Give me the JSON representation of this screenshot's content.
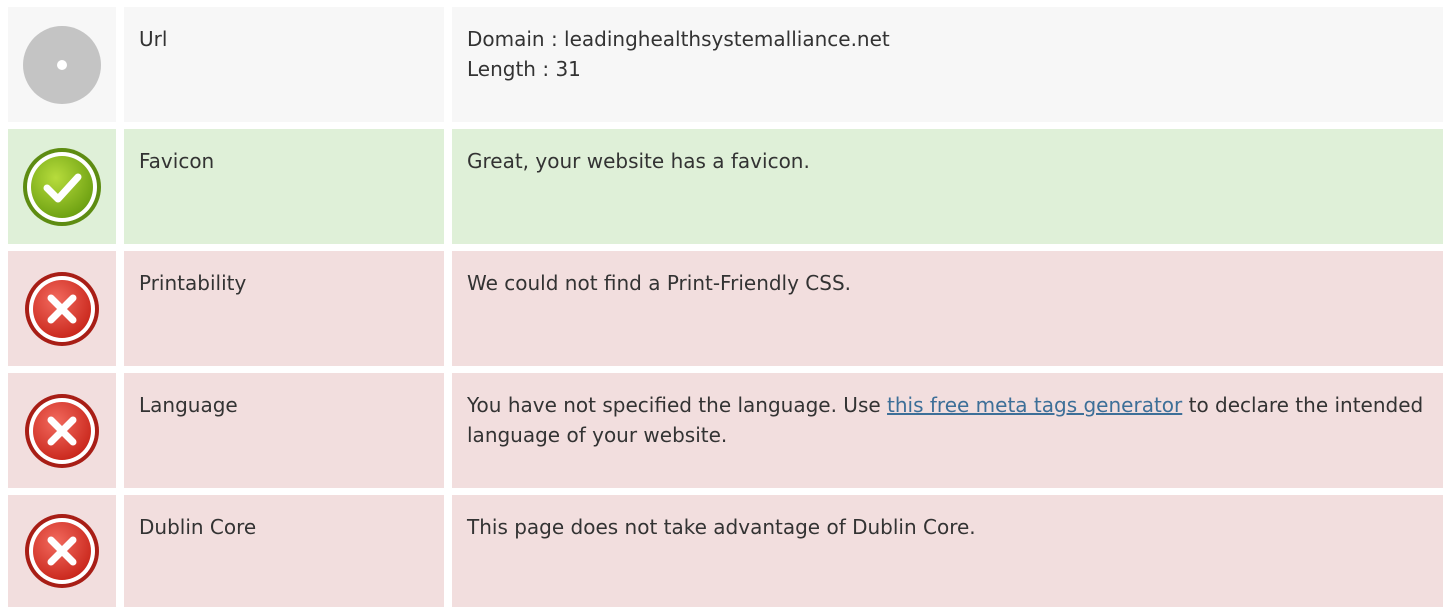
{
  "rows": [
    {
      "status": "neutral",
      "icon": "neutral-circle-icon",
      "label": "Url",
      "lines": [
        "Domain : leadinghealthsystemalliance.net",
        "Length : 31"
      ]
    },
    {
      "status": "good",
      "icon": "checkmark-icon",
      "label": "Favicon",
      "text": "Great, your website has a favicon."
    },
    {
      "status": "bad",
      "icon": "error-x-icon",
      "label": "Printability",
      "text": "We could not find a Print-Friendly CSS."
    },
    {
      "status": "bad",
      "icon": "error-x-icon",
      "label": "Language",
      "text_before": "You have not specified the language. Use ",
      "link_text": "this free meta tags generator",
      "text_after": " to declare the intended language of your website."
    },
    {
      "status": "bad",
      "icon": "error-x-icon",
      "label": "Dublin Core",
      "text": "This page does not take advantage of Dublin Core."
    }
  ],
  "colors": {
    "neutral_bg": "#f7f7f7",
    "good_bg": "#dff0d8",
    "bad_bg": "#f2dede",
    "link": "#3d6f98",
    "text": "#333333"
  }
}
